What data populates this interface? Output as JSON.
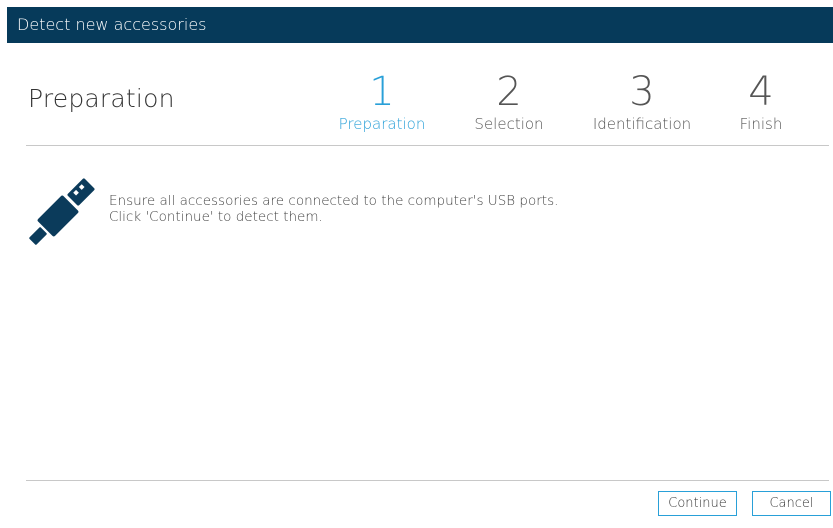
{
  "window": {
    "title": "Detect new accessories"
  },
  "page": {
    "heading": "Preparation"
  },
  "steps": [
    {
      "number": "1",
      "label": "Preparation",
      "active": true
    },
    {
      "number": "2",
      "label": "Selection",
      "active": false
    },
    {
      "number": "3",
      "label": "Identification",
      "active": false
    },
    {
      "number": "4",
      "label": "Finish",
      "active": false
    }
  ],
  "content": {
    "icon": "usb-plug-icon",
    "line1": "Ensure all accessories are connected to the computer's USB ports.",
    "line2": "Click 'Continue' to detect them."
  },
  "buttons": {
    "continue_label": "Continue",
    "cancel_label": "Cancel"
  },
  "colors": {
    "titlebar": "#063a5a",
    "accent": "#29a0d8",
    "icon": "#0b3b5b"
  }
}
